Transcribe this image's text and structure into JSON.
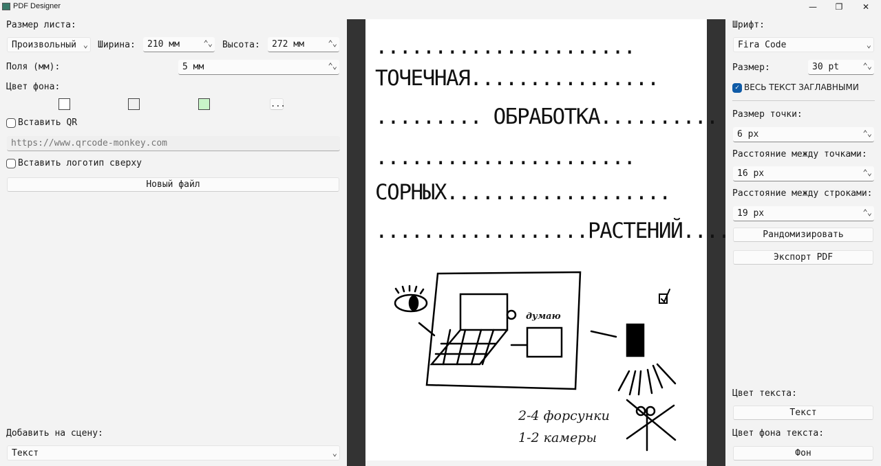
{
  "window": {
    "title": "PDF Designer",
    "minimize": "—",
    "maximize": "❐",
    "close": "✕"
  },
  "left": {
    "sheet_size_label": "Размер листа:",
    "sheet_preset": "Произвольный",
    "width_label": "Ширина:",
    "width_value": "210 мм",
    "height_label": "Высота:",
    "height_value": "272 мм",
    "margins_label": "Поля (мм):",
    "margins_value": "5 мм",
    "bg_color_label": "Цвет фона:",
    "bg_swatches": [
      "#ffffff",
      "#f0f0f0",
      "#c8f5c8"
    ],
    "more_colors": "...",
    "insert_qr_label": "Вставить QR",
    "qr_url_placeholder": "https://www.qrcode-monkey.com",
    "insert_logo_label": "Вставить логотип сверху",
    "new_file": "Новый файл",
    "add_to_scene_label": "Добавить на сцену:",
    "add_to_scene_value": "Текст"
  },
  "preview": {
    "lines": [
      "......................",
      "ТОЧЕЧНАЯ................",
      "......... ОБРАБОТКА..........",
      "......................",
      "СОРНЫХ...................",
      "..................РАСТЕНИЙ...."
    ],
    "sketch": {
      "think": "думаю",
      "note1": "2-4 форсунки",
      "note2": "1-2 камеры"
    }
  },
  "right": {
    "font_label": "Шрифт:",
    "font_value": "Fira Code",
    "size_label": "Размер:",
    "size_value": "30 pt",
    "all_caps_label": "ВЕСЬ ТЕКСТ ЗАГЛАВНЫМИ",
    "all_caps_checked": true,
    "dot_size_label": "Размер точки:",
    "dot_size_value": "6 px",
    "dot_spacing_label": "Расстояние между точками:",
    "dot_spacing_value": "16 px",
    "line_spacing_label": "Расстояние между строками:",
    "line_spacing_value": "19 px",
    "randomize": "Рандомизировать",
    "export_pdf": "Экспорт PDF",
    "text_color_label": "Цвет текста:",
    "text_color_button": "Текст",
    "text_bg_label": "Цвет фона текста:",
    "text_bg_button": "Фон"
  },
  "colors": {
    "accent": "#0f5ba7",
    "preview_border": "#333333"
  }
}
